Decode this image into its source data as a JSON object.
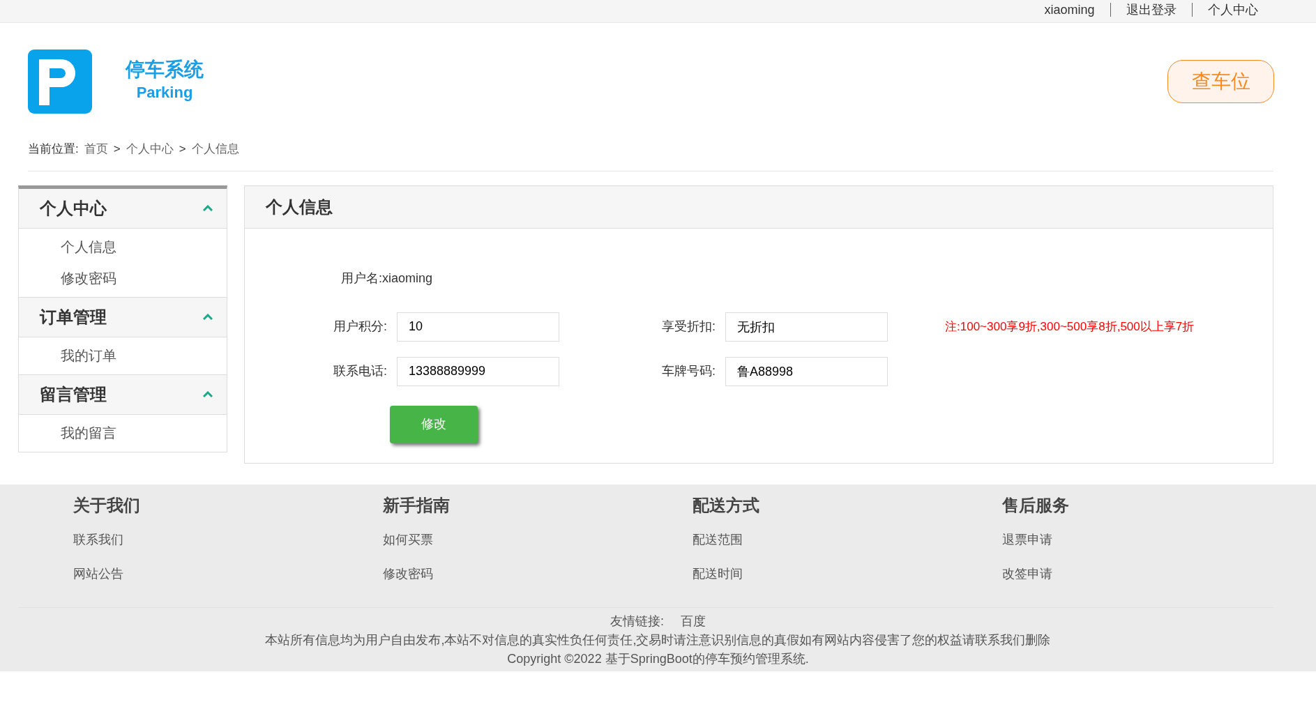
{
  "top_bar": {
    "links": [
      "xiaoming",
      "退出登录",
      "个人中心"
    ]
  },
  "logo": {
    "title": "停车系统",
    "subtitle": "Parking"
  },
  "search_button": "查车位",
  "breadcrumb": {
    "label": "当前位置:",
    "items": [
      "首页",
      "个人中心",
      "个人信息"
    ],
    "separator": ">"
  },
  "sidebar": {
    "groups": [
      {
        "title": "个人中心",
        "expanded": true,
        "items": [
          "个人信息",
          "修改密码"
        ]
      },
      {
        "title": "订单管理",
        "expanded": true,
        "items": [
          "我的订单"
        ]
      },
      {
        "title": "留言管理",
        "expanded": true,
        "items": [
          "我的留言"
        ]
      }
    ]
  },
  "panel": {
    "title": "个人信息",
    "username": {
      "label": "用户名:",
      "value": "xiaoming"
    },
    "rows": [
      {
        "fields": [
          {
            "label": "用户积分:",
            "value": "10"
          },
          {
            "label": "享受折扣:",
            "value": "无折扣"
          }
        ],
        "note": "注:100~300享9折,300~500享8折,500以上享7折"
      },
      {
        "fields": [
          {
            "label": "联系电话:",
            "value": "13388889999"
          },
          {
            "label": "车牌号码:",
            "value": "鲁A88998"
          }
        ]
      }
    ],
    "submit": "修改"
  },
  "footer": {
    "columns": [
      {
        "title": "关于我们",
        "links": [
          "联系我们",
          "网站公告"
        ]
      },
      {
        "title": "新手指南",
        "links": [
          "如何买票",
          "修改密码"
        ]
      },
      {
        "title": "配送方式",
        "links": [
          "配送范围",
          "配送时间"
        ]
      },
      {
        "title": "售后服务",
        "links": [
          "退票申请",
          "改签申请"
        ]
      }
    ],
    "friend_links": {
      "label": "友情链接:",
      "links": [
        "百度"
      ]
    },
    "disclaimer": "本站所有信息均为用户自由发布,本站不对信息的真实性负任何责任,交易时请注意识别信息的真假如有网站内容侵害了您的权益请联系我们删除",
    "copyright": "Copyright ©2022 基于SpringBoot的停车预约管理系统."
  }
}
